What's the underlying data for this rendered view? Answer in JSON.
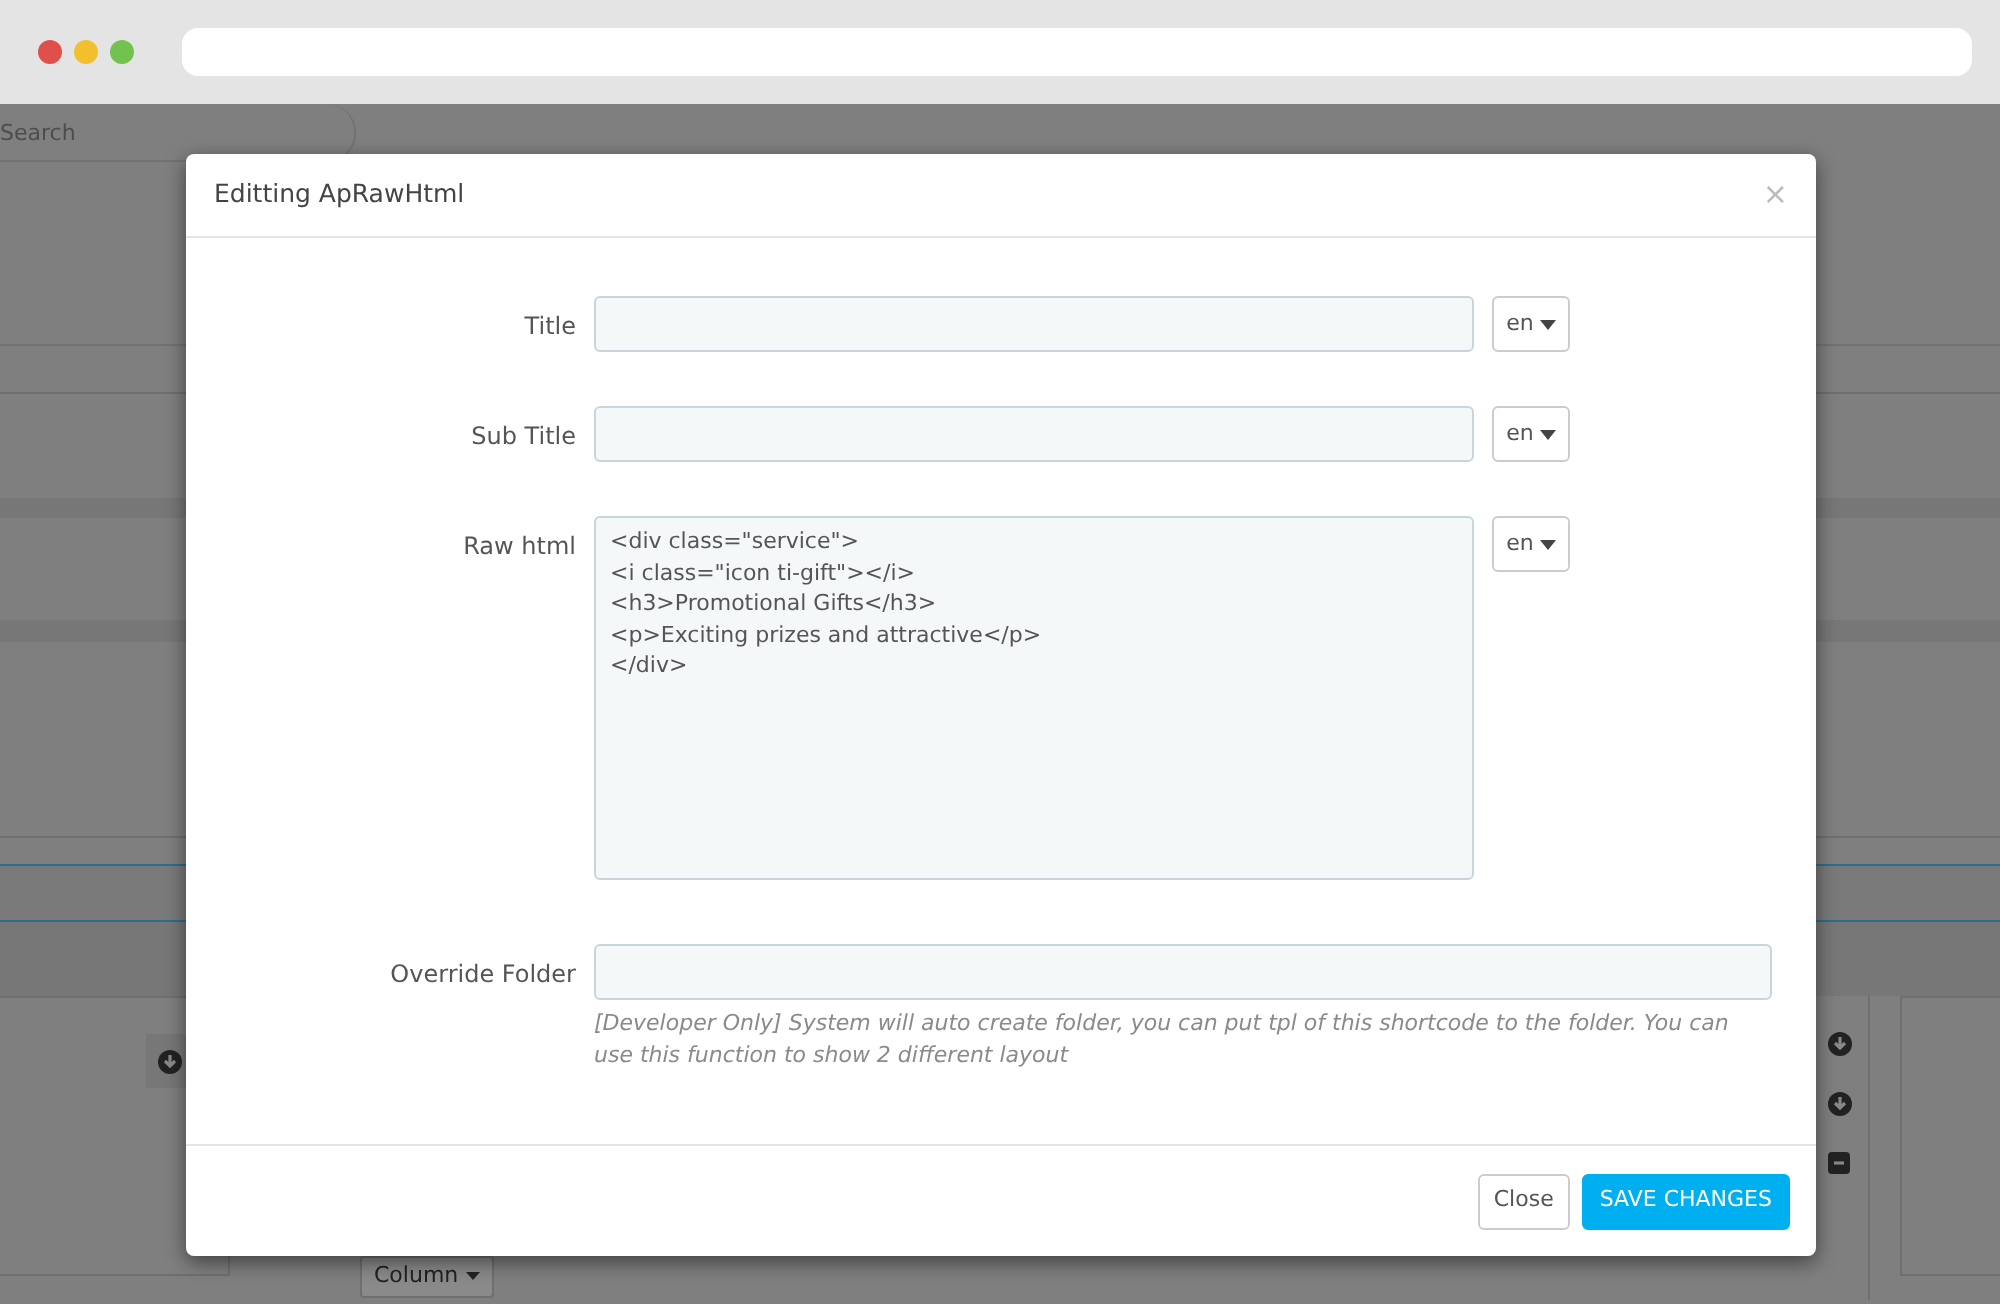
{
  "background": {
    "search": {
      "placeholder": "Search"
    },
    "column_button": {
      "label": "Column"
    }
  },
  "modal": {
    "title": "Editting ApRawHtml",
    "close": "×",
    "fields": [
      {
        "kind": "input",
        "label": "Title",
        "language": "en"
      },
      {
        "kind": "input",
        "label": "Sub Title",
        "language": "en"
      },
      {
        "kind": "textarea",
        "label": "Raw html",
        "value": "<div class=\"service\">\n<i class=\"icon ti-gift\"></i>\n<h3>Promotional Gifts</h3>\n<p>Exciting prizes and attractive</p>\n</div>",
        "language": "en"
      },
      {
        "kind": "input",
        "label": "Override Folder",
        "help": "[Developer Only] System will auto create folder, you can put tpl of this shortcode to the folder. You can use this function to show 2 different layout"
      }
    ],
    "buttons": [
      {
        "label": "Close",
        "kind": "default"
      },
      {
        "label": "SAVE CHANGES",
        "kind": "primary"
      }
    ]
  }
}
